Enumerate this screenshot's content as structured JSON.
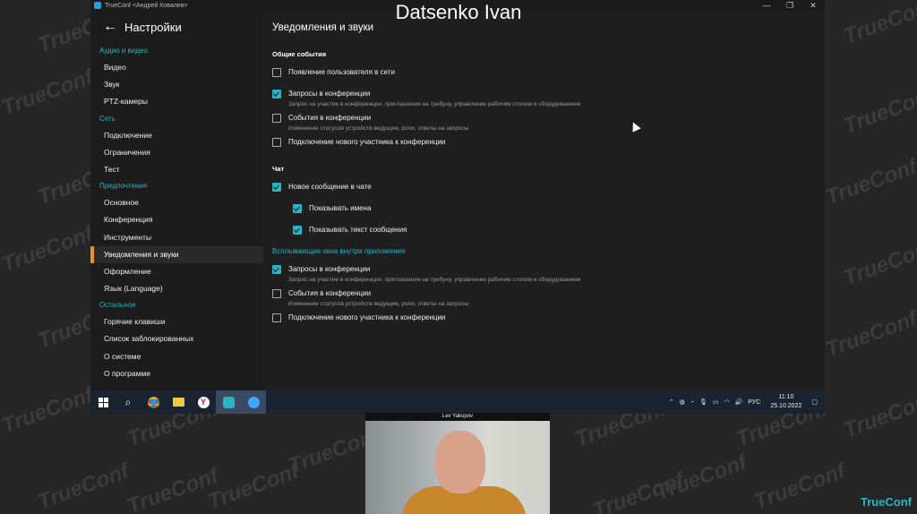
{
  "watermark": "TrueConf",
  "speaker_label": "Datsenko Ivan",
  "window": {
    "title": "TrueConf <Андрей Ковалев>",
    "controls": [
      "—",
      "❐",
      "✕"
    ]
  },
  "sidebar": {
    "title": "Настройки",
    "sections": [
      {
        "label": "Аудио и видео",
        "items": [
          "Видео",
          "Звук",
          "PTZ-камеры"
        ]
      },
      {
        "label": "Сеть",
        "items": [
          "Подключение",
          "Ограничения",
          "Тест"
        ]
      },
      {
        "label": "Предпочтения",
        "items": [
          "Основное",
          "Конференция",
          "Инструменты",
          "Уведомления и звуки",
          "Оформление",
          "Язык (Language)"
        ]
      },
      {
        "label": "Остальное",
        "items": [
          "Горячие клавиши",
          "Список заблокированных",
          "О системе",
          "О программе"
        ]
      }
    ],
    "active_item": "Уведомления и звуки"
  },
  "content": {
    "title": "Уведомления и звуки",
    "general": {
      "label": "Общие события",
      "options": [
        {
          "label": "Появление пользователя в сети",
          "desc": "",
          "checked": false
        },
        {
          "label": "Запросы в конференции",
          "desc": "Запрос на участие в конференции, приглашения на трибуну, управление рабочим столом и оборудованием",
          "checked": true
        },
        {
          "label": "События в конференции",
          "desc": "Изменение статусов устройств ведущим, роли, ответы на запросы",
          "checked": false
        },
        {
          "label": "Подключение нового участника к конференции",
          "desc": "",
          "checked": false
        }
      ]
    },
    "chat": {
      "label": "Чат",
      "new_message": {
        "label": "Новое сообщение в чате",
        "checked": true
      },
      "show_names": {
        "label": "Показывать имена",
        "checked": true
      },
      "show_text": {
        "label": "Показывать текст сообщения",
        "checked": true
      }
    },
    "popups": {
      "label": "Всплывающие окна внутри приложения",
      "options": [
        {
          "label": "Запросы в конференции",
          "desc": "Запрос на участие в конференции, приглашения на трибуну, управление рабочим столом и оборудованием",
          "checked": true
        },
        {
          "label": "События в конференции",
          "desc": "Изменение статусов устройств ведущим, роли, ответы на запросы",
          "checked": false
        },
        {
          "label": "Подключение нового участника к конференции",
          "desc": "",
          "checked": false
        }
      ]
    }
  },
  "taskbar": {
    "apps": [
      "windows-start",
      "search",
      "chrome",
      "file-explorer",
      "yandex-browser",
      "trueconf-room",
      "trueconf-client"
    ],
    "tray": {
      "lang": "РУС",
      "time": "11:10",
      "date": "25.10.2022"
    }
  },
  "camera": {
    "name": "Lev Yakupov"
  },
  "brand": "TrueConf",
  "colors": {
    "accent": "#2ab3c4",
    "active_marker": "#f0911c",
    "taskbar": "#1a2330"
  }
}
